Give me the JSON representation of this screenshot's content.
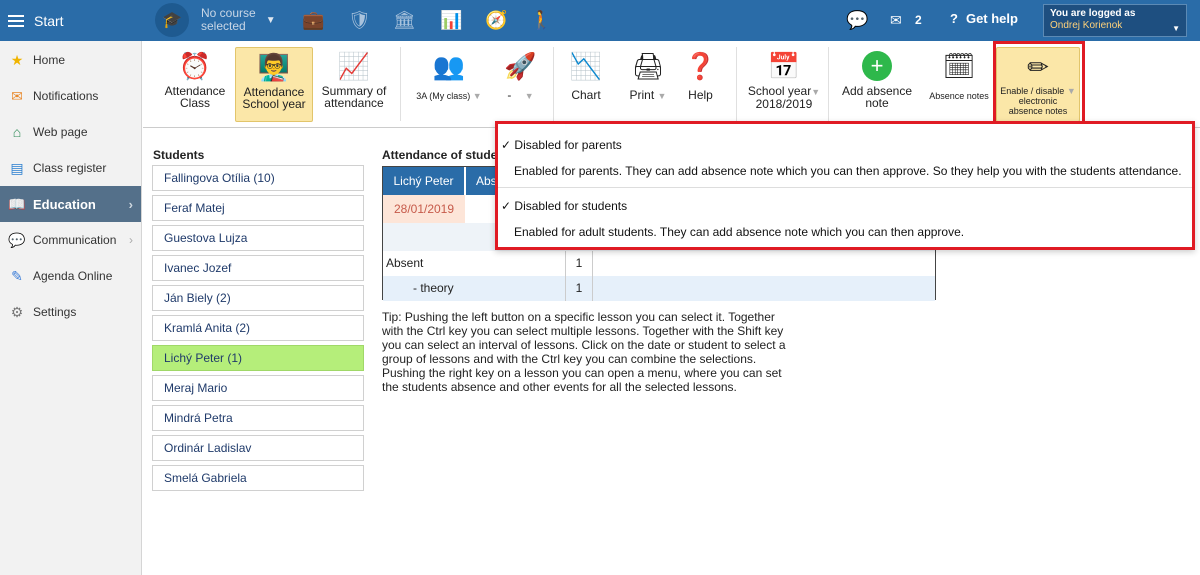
{
  "topbar": {
    "start_label": "Start",
    "course_line1": "No course",
    "course_line2": "selected",
    "mail_count": "2",
    "help_label": "Get help",
    "user_label": "You are logged as",
    "user_name": "Ondrej Korienok"
  },
  "sidebar": {
    "items": [
      {
        "label": "Home"
      },
      {
        "label": "Notifications"
      },
      {
        "label": "Web page"
      },
      {
        "label": "Class register"
      },
      {
        "label": "Education"
      },
      {
        "label": "Communication"
      },
      {
        "label": "Agenda Online"
      },
      {
        "label": "Settings"
      }
    ]
  },
  "toolbar": {
    "attendance_class_1": "Attendance",
    "attendance_class_2": "Class",
    "attendance_year_1": "Attendance",
    "attendance_year_2": "School year",
    "summary_1": "Summary of",
    "summary_2": "attendance",
    "class_select": "3A (My class)",
    "dash_select": "-",
    "chart": "Chart",
    "print": "Print",
    "help": "Help",
    "school_year_1": "School year",
    "school_year_2": "2018/2019",
    "add_absence_1": "Add absence",
    "add_absence_2": "note",
    "absence_notes": "Absence notes",
    "enable_1": "Enable / disable",
    "enable_2": "electronic",
    "enable_3": "absence notes"
  },
  "students": {
    "heading": "Students",
    "list": [
      "Fallingova Otília (10)",
      "Feraf Matej",
      "Guestova Lujza",
      "Ivanec Jozef",
      "Ján Biely (2)",
      "Kramlá Anita (2)",
      "Lichý Peter (1)",
      "Meraj Mario",
      "Mindrá Petra",
      "Ordinár Ladislav",
      "Smelá Gabriela"
    ],
    "selected_index": 6
  },
  "attendance": {
    "heading": "Attendance of stude",
    "student_name": "Lichý Peter",
    "col_abs": "Abs",
    "date": "28/01/2019",
    "rows": [
      {
        "label": "Absent",
        "value": "1"
      },
      {
        "label": "- theory",
        "value": "1"
      }
    ]
  },
  "tip": {
    "p1": "Tip: Pushing the left button on a specific lesson you can select it. Together with the Ctrl key you can select multiple lessons. Together with the Shift key you can select an interval of lessons. Click on the date or student to select a group of lessons and with the Ctrl key you can combine the selections.",
    "p2": "Pushing the right key on a lesson you can open a menu, where you can set the students absence and other events for all the selected lessons."
  },
  "dropdown": {
    "parents_option": "Disabled for parents",
    "parents_desc": "Enabled for parents. They can add absence note which you can then approve. So they help you with the students attendance.",
    "students_option": "Disabled for students",
    "students_desc": "Enabled for adult students. They can add absence note which you can then approve.",
    "check_mark": "✓"
  },
  "colors": {
    "topbar": "#2a6ca8",
    "selected_student": "#b5ee7a",
    "highlight_box": "#e01b24",
    "selected_tool": "#fbe7a8"
  }
}
